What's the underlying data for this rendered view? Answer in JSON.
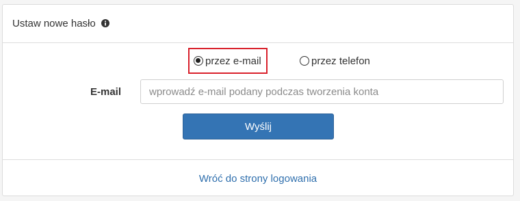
{
  "panel": {
    "title": "Ustaw nowe hasło",
    "info_icon": "info-circle-icon"
  },
  "method": {
    "options": [
      {
        "label": "przez e-mail",
        "checked": true
      },
      {
        "label": "przez telefon",
        "checked": false
      }
    ],
    "highlight_color": "#d9202b"
  },
  "email": {
    "label": "E-mail",
    "value": "",
    "placeholder": "wprowadź e-mail podany podczas tworzenia konta"
  },
  "submit": {
    "label": "Wyślij",
    "color": "#3474b4"
  },
  "back_link": {
    "label": "Wróć do strony logowania",
    "color": "#2f6fad"
  }
}
